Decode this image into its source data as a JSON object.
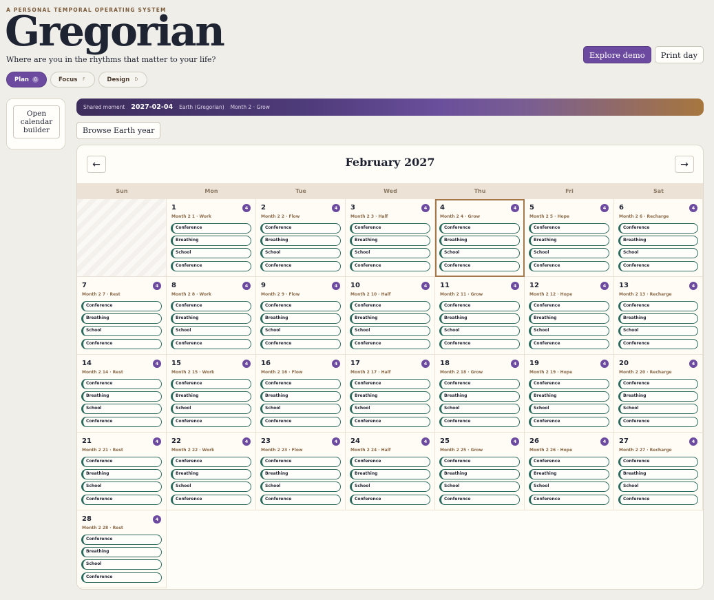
{
  "header": {
    "eyebrow": "A PERSONAL TEMPORAL OPERATING SYSTEM",
    "brand": "Gregorian",
    "tagline": "Where are you in the rhythms that matter to your life?",
    "explore_demo": "Explore demo",
    "print_day": "Print day"
  },
  "modes": [
    {
      "label": "Plan",
      "key": "G",
      "active": true
    },
    {
      "label": "Focus",
      "key": "F",
      "active": false
    },
    {
      "label": "Design",
      "key": "D",
      "active": false
    }
  ],
  "side": {
    "builder_button": "Open calendar builder"
  },
  "shared_moment": {
    "label": "Shared moment",
    "date": "2027-02-04",
    "calendar": "Earth (Gregorian)",
    "month_info": "Month 2 · Grow"
  },
  "browse_button": "Browse Earth year",
  "calendar": {
    "title": "February 2027",
    "prev": "←",
    "next": "→",
    "weekdays": [
      "Sun",
      "Mon",
      "Tue",
      "Wed",
      "Thu",
      "Fri",
      "Sat"
    ],
    "days": [
      {
        "num": "1",
        "label": "Month 2 1 · Work",
        "count": "4"
      },
      {
        "num": "2",
        "label": "Month 2 2 · Flow",
        "count": "4"
      },
      {
        "num": "3",
        "label": "Month 2 3 · Half",
        "count": "4"
      },
      {
        "num": "4",
        "label": "Month 2 4 · Grow",
        "count": "4"
      },
      {
        "num": "5",
        "label": "Month 2 5 · Hope",
        "count": "4"
      },
      {
        "num": "6",
        "label": "Month 2 6 · Recharge",
        "count": "4"
      },
      {
        "num": "7",
        "label": "Month 2 7 · Rest",
        "count": "4"
      },
      {
        "num": "8",
        "label": "Month 2 8 · Work",
        "count": "4"
      },
      {
        "num": "9",
        "label": "Month 2 9 · Flow",
        "count": "4"
      },
      {
        "num": "10",
        "label": "Month 2 10 · Half",
        "count": "4"
      },
      {
        "num": "11",
        "label": "Month 2 11 · Grow",
        "count": "4"
      },
      {
        "num": "12",
        "label": "Month 2 12 · Hope",
        "count": "4"
      },
      {
        "num": "13",
        "label": "Month 2 13 · Recharge",
        "count": "4"
      },
      {
        "num": "14",
        "label": "Month 2 14 · Rest",
        "count": "4"
      },
      {
        "num": "15",
        "label": "Month 2 15 · Work",
        "count": "4"
      },
      {
        "num": "16",
        "label": "Month 2 16 · Flow",
        "count": "4"
      },
      {
        "num": "17",
        "label": "Month 2 17 · Half",
        "count": "4"
      },
      {
        "num": "18",
        "label": "Month 2 18 · Grow",
        "count": "4"
      },
      {
        "num": "19",
        "label": "Month 2 19 · Hope",
        "count": "4"
      },
      {
        "num": "20",
        "label": "Month 2 20 · Recharge",
        "count": "4"
      },
      {
        "num": "21",
        "label": "Month 2 21 · Rest",
        "count": "4"
      },
      {
        "num": "22",
        "label": "Month 2 22 · Work",
        "count": "4"
      },
      {
        "num": "23",
        "label": "Month 2 23 · Flow",
        "count": "4"
      },
      {
        "num": "24",
        "label": "Month 2 24 · Half",
        "count": "4"
      },
      {
        "num": "25",
        "label": "Month 2 25 · Grow",
        "count": "4"
      },
      {
        "num": "26",
        "label": "Month 2 26 · Hope",
        "count": "4"
      },
      {
        "num": "27",
        "label": "Month 2 27 · Recharge",
        "count": "4"
      },
      {
        "num": "28",
        "label": "Month 2 28 · Rest",
        "count": "4"
      }
    ],
    "events": [
      "Conference",
      "Breathing",
      "School",
      "Conference"
    ],
    "today": "4"
  },
  "colors": {
    "accent": "#6c4aa0",
    "event_border": "#2c6a5e",
    "today_outline": "#a4784a",
    "background": "#efeee9"
  }
}
